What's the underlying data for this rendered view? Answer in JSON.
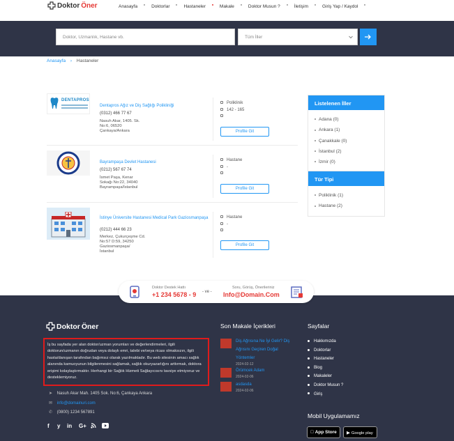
{
  "header": {
    "logo_text_a": "Doktor",
    "logo_text_b": "Öner",
    "nav": [
      {
        "label": "Anasayfa"
      },
      {
        "label": "Doktorlar"
      },
      {
        "label": "Hastaneler"
      },
      {
        "label": "Makale"
      },
      {
        "label": "Doktor Musun ?"
      },
      {
        "label": "İletişim"
      },
      {
        "label": "Giriş Yap / Kaydol"
      }
    ]
  },
  "search": {
    "placeholder": "Doktor, Uzmanlık, Hastane vb.",
    "city_select": "Tüm İller"
  },
  "breadcrumb": {
    "home": "Anasayfa",
    "current": "Hastaneler"
  },
  "listings": [
    {
      "name": "Dentapros Ağız ve Diş Sağlığı Polikliniği",
      "phone": "(0312) 466 77 67",
      "address": [
        "Nasuh Akar, 1405. Sk.",
        "No:6, 06520",
        "Çankaya/Ankara"
      ],
      "meta": [
        "Poliklinik",
        "142 - 165",
        ""
      ],
      "button": "Profile Git",
      "thumb_text": "DENTAPROS"
    },
    {
      "name": "Bayrampaşa Devlet Hastanesi",
      "phone": "(0212) 567 67 74",
      "address": [
        "İsmet Paşa, Kenar",
        "Sokağı No:22, 34040",
        "Bayrampaşa/İstanbul"
      ],
      "meta": [
        "Hastane",
        "-",
        ""
      ],
      "button": "Profile Git"
    },
    {
      "name": "İstinye Üniversite Hastanesi Medical Park Gaziosmanpaşa",
      "phone": "(0212) 444 66 23",
      "address": [
        "Merkez, Çukurçeşme Cd.",
        "No:57 D:59, 34250",
        "Gaziosmanpaşa/",
        "İstanbul"
      ],
      "meta": [
        "Hastane",
        "-",
        ""
      ],
      "button": "Profile Git"
    }
  ],
  "sidebar": {
    "cities_title": "Listelenen İller",
    "cities": [
      "Adana (0)",
      "Ankara (1)",
      "Çanakkale (0)",
      "İstanbul (2)",
      "İzmir (0)"
    ],
    "types_title": "Tür Tipi",
    "types": [
      "Poliklinik (1)",
      "Hastane (2)"
    ]
  },
  "support": {
    "line_label": "Doktor Destek Hattı",
    "phone": "+1 234 5678 - 9",
    "or": "- ve -",
    "mail_label": "Soru, Görüş, Önerileriniz",
    "email": "Info@Domain.Com"
  },
  "footer": {
    "description": "İş bu sayfada yer alan doktor/uzman yorumları ve değerlendirmeleri, ilgili doktorun/uzmanın doğrudan veya dolaylı emri, talebi ve/veya ricası olmaksızın, ilgili hasta/danışan tarafından bağımsız olarak yazılmaktadır. Bu web sitesinin amacı sağlık alanında kamuoyunun bilgilenmesini sağlamak, sağlık okuryazarlığını arttırmak, doktora erişimi kolaylaştırmaktır. Herhangi bir Sağlık Hizmeti Sağlayıcısını tavsiye etmiyoruz ve desteklemiyoruz.",
    "address": "Nasuh Akar Mah. 1405 Sok. No:6, Çankaya Ankara",
    "email": "info@domainuri.com",
    "phone": "(0800) 1234 567891",
    "articles_title": "Son Makale İçerikleri",
    "articles": [
      {
        "title_lines": [
          "Diş Ağrısına Ne İyi Gelir? Diş",
          "Ağrısını Geçiren Doğal",
          "Yöntemler"
        ],
        "date": "2024-02-12"
      },
      {
        "title_lines": [
          "Örümcek Adam"
        ],
        "date": "2024-02-06"
      },
      {
        "title_lines": [
          "asdasda"
        ],
        "date": "2024-02-06"
      }
    ],
    "pages_title": "Sayfalar",
    "pages": [
      "Hakkımızda",
      "Doktorlar",
      "Hastaneler",
      "Blog",
      "Makaleler",
      "Doktor Musun ?",
      "Giriş"
    ],
    "app_title": "Mobil Uygulamamız",
    "app_store": "App Store",
    "google_play": "Google play",
    "socials": [
      "f",
      "y",
      "in",
      "G+",
      "rss",
      "yt"
    ]
  },
  "colors": {
    "accent": "#2196f3",
    "navy": "#2f3447",
    "brand_red": "#e53935"
  }
}
